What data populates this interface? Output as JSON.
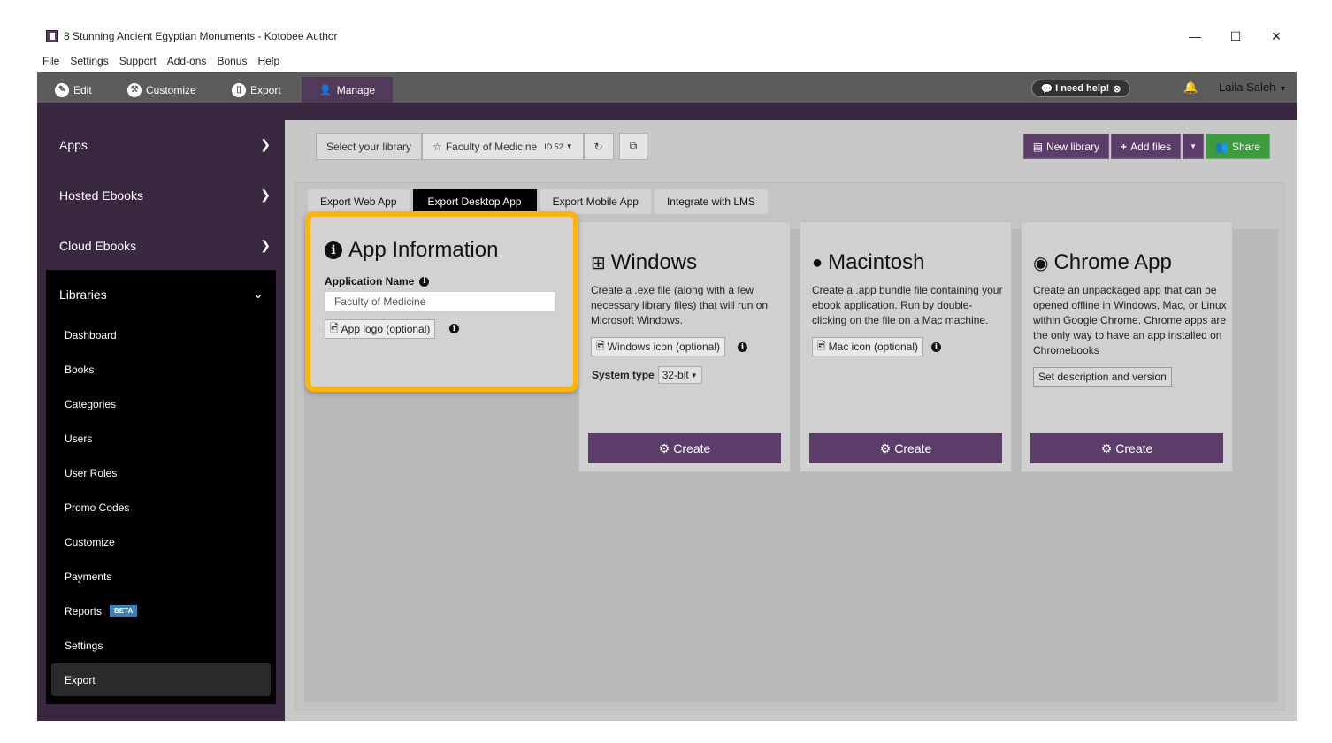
{
  "window": {
    "title": "8 Stunning Ancient Egyptian Monuments - Kotobee Author",
    "controls": {
      "minimize": "—",
      "maximize": "☐",
      "close": "✕"
    }
  },
  "menu": [
    "File",
    "Settings",
    "Support",
    "Add-ons",
    "Bonus",
    "Help"
  ],
  "top_tabs": [
    {
      "label": "Edit",
      "icon": "pencil-icon"
    },
    {
      "label": "Customize",
      "icon": "wrench-icon"
    },
    {
      "label": "Export",
      "icon": "tablet-icon"
    },
    {
      "label": "Manage",
      "icon": "user-icon",
      "active": true
    }
  ],
  "header_right": {
    "help": "I need help!",
    "user": "Laila Saleh"
  },
  "sidebar": {
    "sections": [
      "Apps",
      "Hosted Ebooks",
      "Cloud Ebooks"
    ],
    "libraries": {
      "label": "Libraries",
      "items": [
        "Dashboard",
        "Books",
        "Categories",
        "Users",
        "User Roles",
        "Promo Codes",
        "Customize",
        "Payments",
        "Reports",
        "Settings",
        "Export"
      ],
      "active": "Export",
      "reports_badge": "BETA"
    }
  },
  "library_bar": {
    "select_label": "Select your library",
    "library_name": "Faculty of Medicine",
    "library_id": "ID 52"
  },
  "actions": {
    "new_library": "New library",
    "add_files": "Add files",
    "share": "Share"
  },
  "subtabs": [
    "Export Web App",
    "Export Desktop App",
    "Export Mobile App",
    "Integrate with LMS"
  ],
  "active_subtab": "Export Desktop App",
  "app_info": {
    "title": "App Information",
    "name_label": "Application Name",
    "name_value": "Faculty of Medicine",
    "logo_button": "App logo (optional)"
  },
  "platforms": {
    "windows": {
      "title": "Windows",
      "desc": "Create a .exe file (along with a few necessary library files) that will run on Microsoft Windows.",
      "icon_button": "Windows icon (optional)",
      "system_type_label": "System type",
      "system_type_value": "32-bit",
      "create": "Create"
    },
    "mac": {
      "title": "Macintosh",
      "desc": "Create a .app bundle file containing your ebook application. Run by double-clicking on the file on a Mac machine.",
      "icon_button": "Mac icon (optional)",
      "create": "Create"
    },
    "chrome": {
      "title": "Chrome App",
      "desc": "Create an unpackaged app that can be opened offline in Windows, Mac, or Linux within Google Chrome. Chrome apps are the only way to have an app installed on Chromebooks",
      "desc_button": "Set description and version",
      "create": "Create"
    }
  },
  "colors": {
    "accent": "#5c3c68",
    "highlight": "#ffb400",
    "share": "#3d9a3d",
    "sidebar": "#3a2840"
  }
}
